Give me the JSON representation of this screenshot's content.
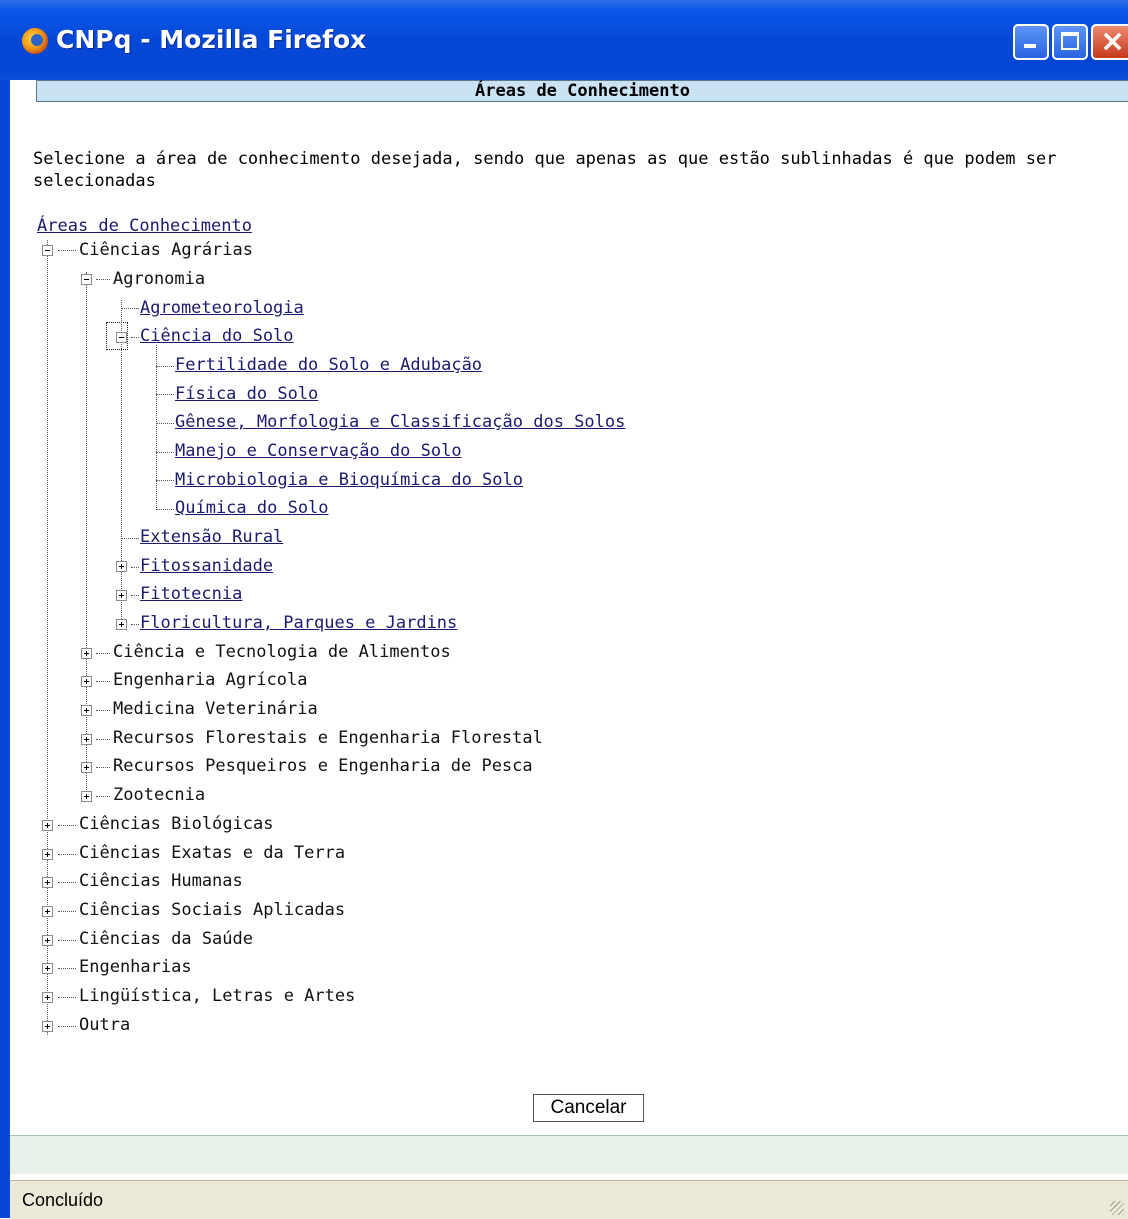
{
  "window": {
    "title": "CNPq - Mozilla Firefox"
  },
  "header": {
    "title": "Áreas de Conhecimento"
  },
  "instructions": "Selecione a área de conhecimento desejada, sendo que apenas as que estão sublinhadas é que podem ser selecionadas",
  "tree": {
    "root": "Áreas de Conhecimento",
    "n1": "Ciências Agrárias",
    "n2": "Agronomia",
    "n3": "Agrometeorologia",
    "n4": "Ciência do Solo",
    "n5": "Fertilidade do Solo e Adubação",
    "n6": "Física do Solo",
    "n7": "Gênese, Morfologia e Classificação dos Solos",
    "n8": "Manejo e Conservação do Solo",
    "n9": "Microbiologia e Bioquímica do Solo",
    "n10": "Química do Solo",
    "n11": "Extensão Rural",
    "n12": "Fitossanidade",
    "n13": "Fitotecnia",
    "n14": "Floricultura, Parques e Jardins",
    "n15": "Ciência e Tecnologia de Alimentos",
    "n16": "Engenharia Agrícola",
    "n17": "Medicina Veterinária",
    "n18": "Recursos Florestais e Engenharia Florestal",
    "n19": "Recursos Pesqueiros e Engenharia de Pesca",
    "n20": "Zootecnia",
    "n21": "Ciências Biológicas",
    "n22": "Ciências Exatas e da Terra",
    "n23": "Ciências Humanas",
    "n24": "Ciências Sociais Aplicadas",
    "n25": "Ciências da Saúde",
    "n26": "Engenharias",
    "n27": "Lingüística, Letras e Artes",
    "n28": "Outra"
  },
  "buttons": {
    "cancel": "Cancelar"
  },
  "status": {
    "text": "Concluído"
  }
}
